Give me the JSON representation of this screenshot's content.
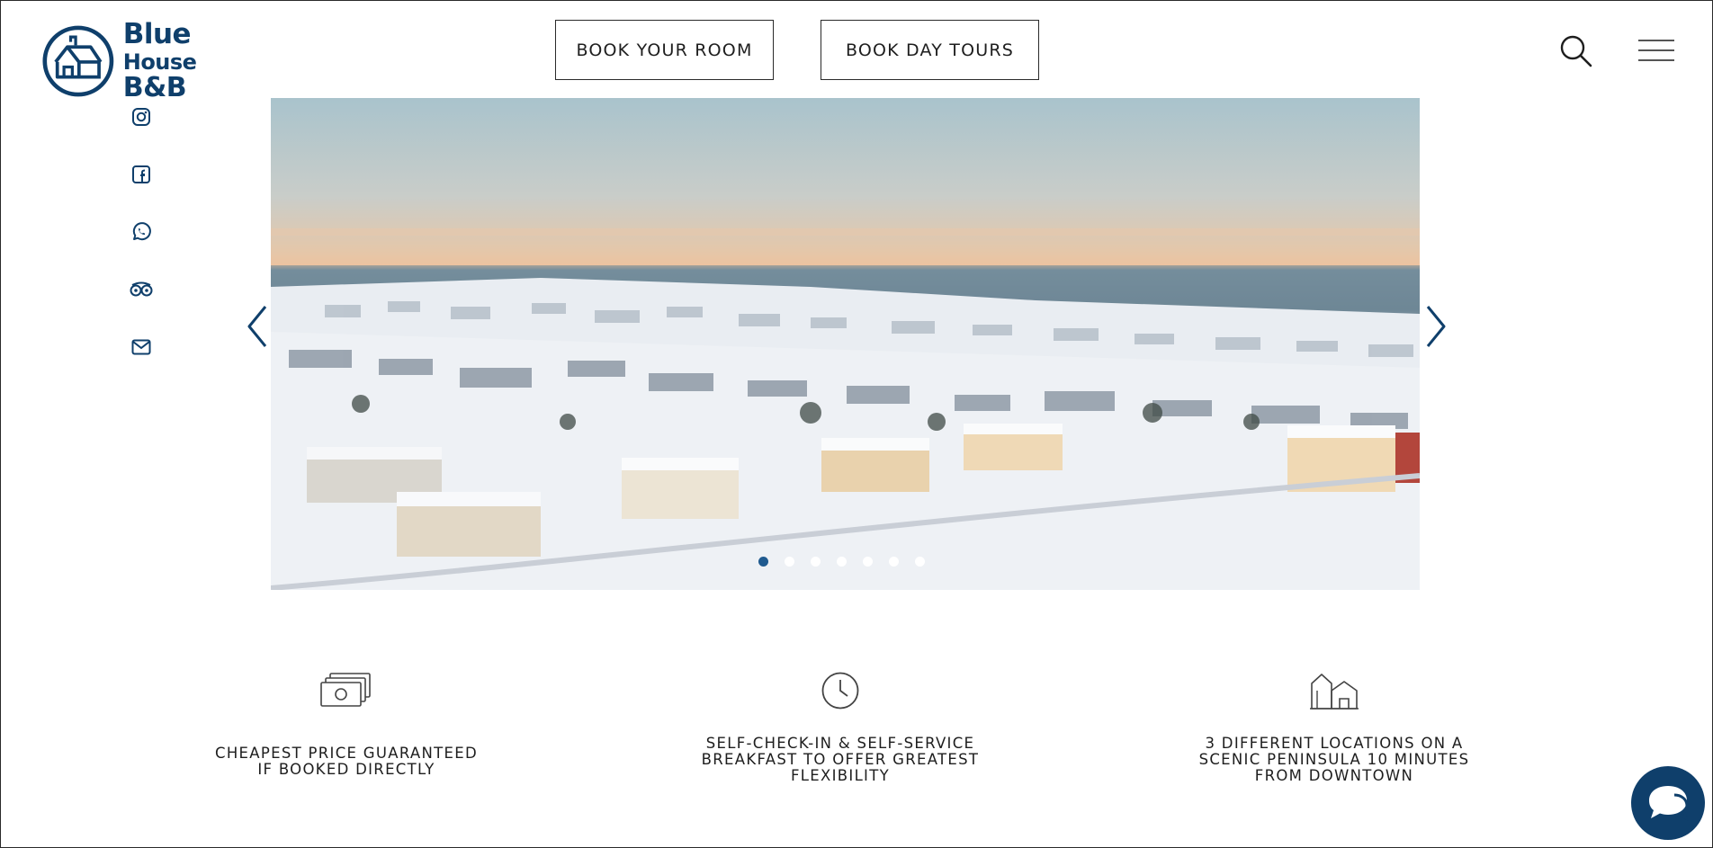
{
  "brand": {
    "line1": "Blue",
    "line2_prefix": "House",
    "line2_suffix": "B&B",
    "color": "#0f3f6b"
  },
  "header": {
    "book_room": "BOOK YOUR ROOM",
    "book_tours": "BOOK DAY TOURS"
  },
  "social": [
    "instagram-icon",
    "facebook-icon",
    "whatsapp-icon",
    "tripadvisor-icon",
    "mail-icon"
  ],
  "slider": {
    "image_alt": "Snowy aerial view of coastal town at sunset",
    "slide_count": 7,
    "active_slide": 1
  },
  "features": [
    {
      "icon": "cash-icon",
      "text": "CHEAPEST PRICE GUARANTEED\nIF BOOKED DIRECTLY"
    },
    {
      "icon": "clock-icon",
      "text": "SELF-CHECK-IN & SELF-SERVICE\nBREAKFAST TO OFFER GREATEST\nFLEXIBILITY"
    },
    {
      "icon": "houses-icon",
      "text": "3 DIFFERENT LOCATIONS ON A\nSCENIC PENINSULA 10 MINUTES\nFROM DOWNTOWN"
    }
  ],
  "colors": {
    "accent": "#0f3f6b",
    "dot_active": "#1f5a8f"
  }
}
